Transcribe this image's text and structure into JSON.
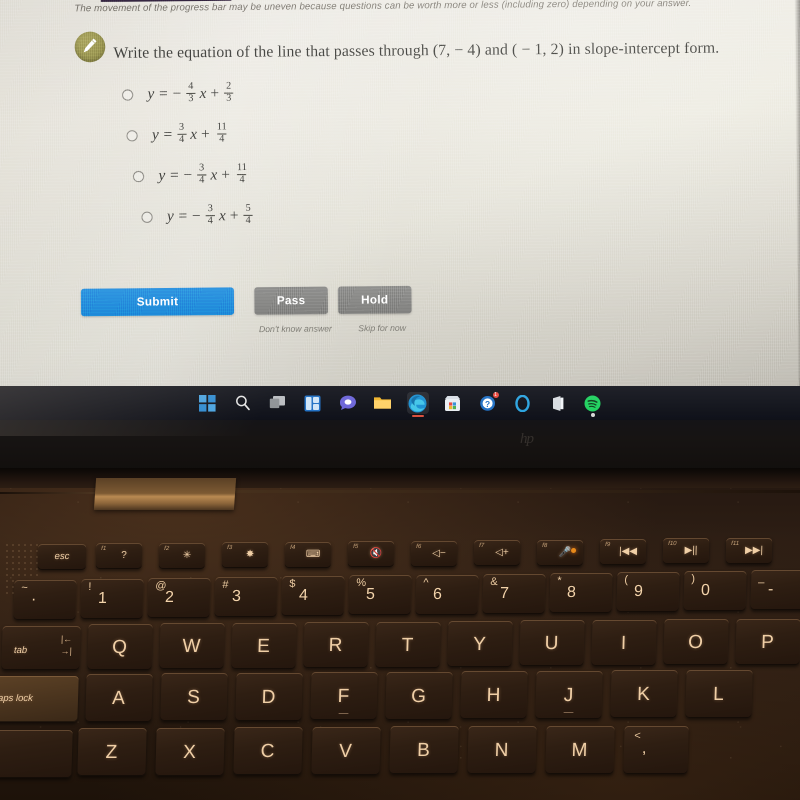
{
  "screen": {
    "progress_note": "The movement of the progress bar may be uneven because questions can be worth more or less (including zero) depending on your answer.",
    "progress_percent": 16,
    "question_icon": "pencil-icon",
    "question": "Write the equation of the line that passes through (7,  − 4) and ( − 1, 2) in slope-intercept form.",
    "choices": [
      {
        "lead": "y =",
        "op": "−",
        "num1": "4",
        "den1": "3",
        "var": "x",
        "plus": "+",
        "num2": "2",
        "den2": "3"
      },
      {
        "lead": "y =",
        "op": "",
        "num1": "3",
        "den1": "4",
        "var": "x",
        "plus": "+",
        "num2": "11",
        "den2": "4"
      },
      {
        "lead": "y =",
        "op": "−",
        "num1": "3",
        "den1": "4",
        "var": "x",
        "plus": "+",
        "num2": "11",
        "den2": "4"
      },
      {
        "lead": "y =",
        "op": "−",
        "num1": "3",
        "den1": "4",
        "var": "x",
        "plus": "+",
        "num2": "5",
        "den2": "4"
      }
    ],
    "buttons": {
      "submit": "Submit",
      "pass": "Pass",
      "hold": "Hold",
      "pass_caption": "Don't know answer",
      "hold_caption": "Skip for now"
    },
    "colors": {
      "submit_blue": "#1c86d8",
      "neutral_gray": "#7e7e7c",
      "badge_olive": "#8e8a48",
      "progress_purple": "#2d1f38"
    }
  },
  "bezel": {
    "brand": "hp",
    "taskbar": [
      {
        "name": "start-icon",
        "label": "Start"
      },
      {
        "name": "search-icon",
        "label": "Search"
      },
      {
        "name": "task-view-icon",
        "label": "Task View"
      },
      {
        "name": "widgets-icon",
        "label": "Widgets"
      },
      {
        "name": "teams-icon",
        "label": "Chat"
      },
      {
        "name": "file-explorer-icon",
        "label": "File Explorer"
      },
      {
        "name": "edge-icon",
        "label": "Microsoft Edge"
      },
      {
        "name": "store-icon",
        "label": "Microsoft Store"
      },
      {
        "name": "help-icon",
        "label": "Get Help"
      },
      {
        "name": "cortana-icon",
        "label": "Cortana"
      },
      {
        "name": "office-icon",
        "label": "Office"
      },
      {
        "name": "spotify-icon",
        "label": "Spotify"
      }
    ],
    "edge_badge": "1"
  },
  "keyboard": {
    "function_row": [
      {
        "fn": "",
        "label": "esc",
        "type": "mod"
      },
      {
        "fn": "f1",
        "label": "?",
        "type": "fkey"
      },
      {
        "fn": "f2",
        "label": "✳",
        "type": "fkey"
      },
      {
        "fn": "f3",
        "label": "✸",
        "type": "fkey"
      },
      {
        "fn": "f4",
        "label": "⌨",
        "type": "fkey"
      },
      {
        "fn": "f5",
        "label": "🔇",
        "type": "fkey"
      },
      {
        "fn": "f6",
        "label": "◁−",
        "type": "fkey"
      },
      {
        "fn": "f7",
        "label": "◁+",
        "type": "fkey"
      },
      {
        "fn": "f8",
        "label": "🎤",
        "type": "fkey"
      },
      {
        "fn": "f9",
        "label": "|◀◀",
        "type": "fkey"
      },
      {
        "fn": "f10",
        "label": "▶||",
        "type": "fkey"
      },
      {
        "fn": "f11",
        "label": "▶▶|",
        "type": "fkey"
      }
    ],
    "number_row": [
      {
        "sub": "~",
        "main": "`"
      },
      {
        "sub": "!",
        "main": "1"
      },
      {
        "sub": "@",
        "main": "2"
      },
      {
        "sub": "#",
        "main": "3"
      },
      {
        "sub": "$",
        "main": "4"
      },
      {
        "sub": "%",
        "main": "5"
      },
      {
        "sub": "^",
        "main": "6"
      },
      {
        "sub": "&",
        "main": "7"
      },
      {
        "sub": "*",
        "main": "8"
      },
      {
        "sub": "(",
        "main": "9"
      },
      {
        "sub": ")",
        "main": "0"
      },
      {
        "sub": "_",
        "main": "-"
      }
    ],
    "tab_label": "tab",
    "tab_arrows": "|←\n→|",
    "qwerty_row": [
      "Q",
      "W",
      "E",
      "R",
      "T",
      "Y",
      "U",
      "I",
      "O",
      "P"
    ],
    "capslock_label": "aps lock",
    "home_row": [
      "A",
      "S",
      "D",
      "F",
      "G",
      "H",
      "J",
      "K",
      "L"
    ],
    "bottom_row": [
      "Z",
      "X",
      "C",
      "V",
      "B",
      "N",
      "M"
    ],
    "comma_key": {
      "sub": "<",
      "main": ","
    }
  }
}
